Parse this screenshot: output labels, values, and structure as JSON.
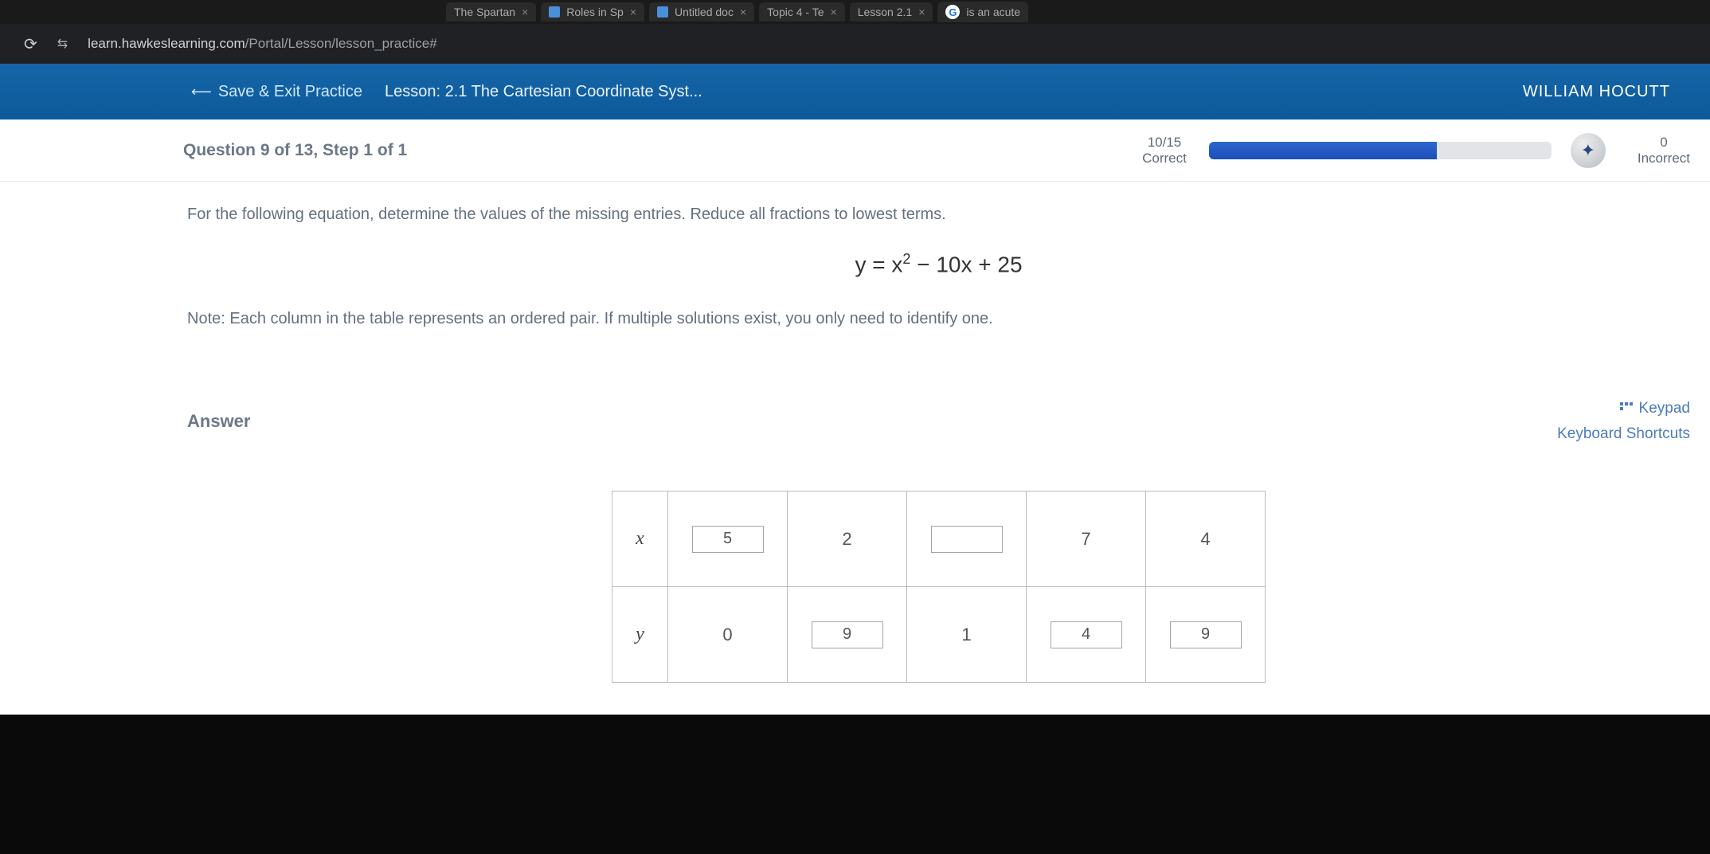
{
  "tabs": [
    {
      "label": "The Spartan"
    },
    {
      "label": "Roles in Sp"
    },
    {
      "label": "Untitled doc"
    },
    {
      "label": "Topic 4 - Te"
    },
    {
      "label": "Lesson 2.1"
    },
    {
      "label": "is an acute"
    }
  ],
  "url": {
    "domain": "learn.hawkeslearning.com",
    "path": "/Portal/Lesson/lesson_practice#"
  },
  "appbar": {
    "save_exit": "Save & Exit Practice",
    "lesson": "Lesson: 2.1 The Cartesian Coordinate Syst...",
    "user": "WILLIAM HOCUTT"
  },
  "progress": {
    "question": "Question 9 of 13,  Step 1 of 1",
    "score": "10/15",
    "score_label": "Correct",
    "incorrect_count": "0",
    "incorrect_label": "Incorrect"
  },
  "content": {
    "instruction": "For the following equation, determine the values of the missing entries. Reduce all fractions to lowest terms.",
    "equation_lhs": "y = x",
    "equation_sup": "2",
    "equation_rhs": " − 10x + 25",
    "note": "Note: Each column in the table represents an ordered pair. If multiple solutions exist, you only need to identify one.",
    "answer_label": "Answer",
    "keypad": "Keypad",
    "shortcuts": "Keyboard Shortcuts"
  },
  "table": {
    "xhdr": "x",
    "yhdr": "y",
    "x": [
      {
        "input": true,
        "value": "5"
      },
      {
        "input": false,
        "value": "2"
      },
      {
        "input": true,
        "value": ""
      },
      {
        "input": false,
        "value": "7"
      },
      {
        "input": false,
        "value": "4"
      }
    ],
    "y": [
      {
        "input": false,
        "value": "0"
      },
      {
        "input": true,
        "value": "9"
      },
      {
        "input": false,
        "value": "1"
      },
      {
        "input": true,
        "value": "4"
      },
      {
        "input": true,
        "value": "9"
      }
    ]
  }
}
